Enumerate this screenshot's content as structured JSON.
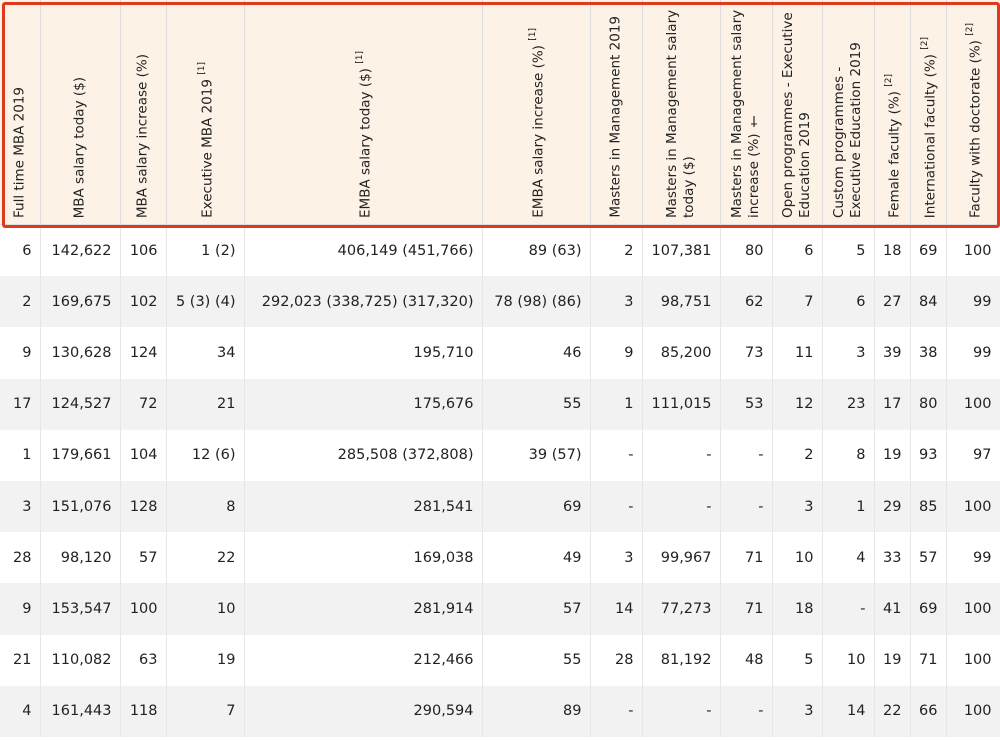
{
  "headers": [
    {
      "label": "Full time MBA 2019",
      "note": ""
    },
    {
      "label": "MBA salary today ($)",
      "note": ""
    },
    {
      "label": "MBA salary increase (%)",
      "note": ""
    },
    {
      "label": "Executive MBA 2019",
      "note": "[1]"
    },
    {
      "label": "EMBA salary today ($)",
      "note": "[1]"
    },
    {
      "label": "EMBA salary increase (%)",
      "note": "[1]"
    },
    {
      "label": "Masters in Management 2019",
      "note": ""
    },
    {
      "label": "Masters in Management salary today ($)",
      "note": ""
    },
    {
      "label": "Masters in Management salary increase (%) †",
      "note": ""
    },
    {
      "label": "Open programmes - Executive Education 2019",
      "note": ""
    },
    {
      "label": "Custom programmes - Executive Education 2019",
      "note": ""
    },
    {
      "label": "Female faculty (%)",
      "note": "[2]"
    },
    {
      "label": "International faculty (%)",
      "note": "[2]"
    },
    {
      "label": "Faculty with doctorate (%)",
      "note": "[2]"
    }
  ],
  "rows": [
    [
      "6",
      "142,622",
      "106",
      "1 (2)",
      "406,149 (451,766)",
      "89 (63)",
      "2",
      "107,381",
      "80",
      "6",
      "5",
      "18",
      "69",
      "100"
    ],
    [
      "2",
      "169,675",
      "102",
      "5 (3) (4)",
      "292,023 (338,725) (317,320)",
      "78 (98) (86)",
      "3",
      "98,751",
      "62",
      "7",
      "6",
      "27",
      "84",
      "99"
    ],
    [
      "9",
      "130,628",
      "124",
      "34",
      "195,710",
      "46",
      "9",
      "85,200",
      "73",
      "11",
      "3",
      "39",
      "38",
      "99"
    ],
    [
      "17",
      "124,527",
      "72",
      "21",
      "175,676",
      "55",
      "1",
      "111,015",
      "53",
      "12",
      "23",
      "17",
      "80",
      "100"
    ],
    [
      "1",
      "179,661",
      "104",
      "12 (6)",
      "285,508 (372,808)",
      "39 (57)",
      "-",
      "-",
      "-",
      "2",
      "8",
      "19",
      "93",
      "97"
    ],
    [
      "3",
      "151,076",
      "128",
      "8",
      "281,541",
      "69",
      "-",
      "-",
      "-",
      "3",
      "1",
      "29",
      "85",
      "100"
    ],
    [
      "28",
      "98,120",
      "57",
      "22",
      "169,038",
      "49",
      "3",
      "99,967",
      "71",
      "10",
      "4",
      "33",
      "57",
      "99"
    ],
    [
      "9",
      "153,547",
      "100",
      "10",
      "281,914",
      "57",
      "14",
      "77,273",
      "71",
      "18",
      "-",
      "41",
      "69",
      "100"
    ],
    [
      "21",
      "110,082",
      "63",
      "19",
      "212,466",
      "55",
      "28",
      "81,192",
      "48",
      "5",
      "10",
      "19",
      "71",
      "100"
    ],
    [
      "4",
      "161,443",
      "118",
      "7",
      "290,594",
      "89",
      "-",
      "-",
      "-",
      "3",
      "14",
      "22",
      "66",
      "100"
    ]
  ],
  "colors": {
    "header_bg": "#fdf2e6",
    "highlight_border": "#e03a1e",
    "row_stripe": "#f2f2f2"
  }
}
